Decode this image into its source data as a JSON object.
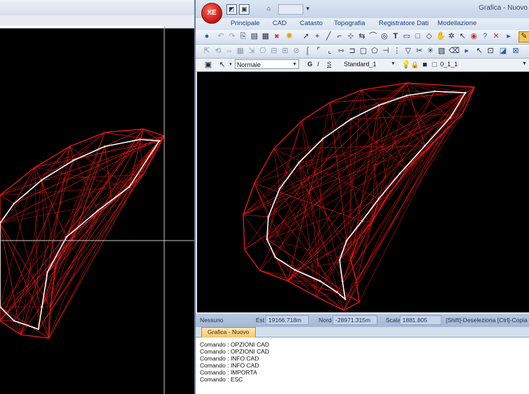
{
  "window": {
    "title": "Grafica - Nuovo",
    "logo_text": "XE"
  },
  "menu": [
    "Principale",
    "CAD",
    "Catasto",
    "Topografia",
    "Registratore Dati",
    "Modellazione"
  ],
  "properties": {
    "style_value": "Normale",
    "bold_label": "G",
    "italic_label": "I",
    "underline_label": "S",
    "font_value": "Standard_1",
    "layer_value": "0_1_1"
  },
  "status": {
    "snap": "Nessuno",
    "est_label": "Est",
    "est_value": "19166.718m",
    "nord_label": "Nord",
    "nord_value": "-28971.315m",
    "scala_label": "Scala",
    "scala_value": "1881.805",
    "hint": "[Shift]-Deseleziona [Ctrl]-Copia [A"
  },
  "document_tab": "Grafica - Nuovo",
  "command_history": [
    "Comando : OPZIONI CAD",
    "Comando : OPZIONI CAD",
    "Comando : INFO CAD",
    "Comando : INFO CAD",
    "Comando : IMPORTA",
    "Comando : ESC"
  ],
  "colors": {
    "canvas_bg": "#000000",
    "mesh_red": "#e01818",
    "road_white": "#ffffff",
    "status_bg": "#b8c9e0",
    "tab_orange": "#f5c76a"
  },
  "icons": [
    "app-logo-icon",
    "save-icon",
    "pointer-icon",
    "line-tool-icon",
    "text-tool-icon",
    "rectangle-tool-icon",
    "circle-tool-icon",
    "pan-hand-icon",
    "lightbulb-icon",
    "lock-icon"
  ]
}
